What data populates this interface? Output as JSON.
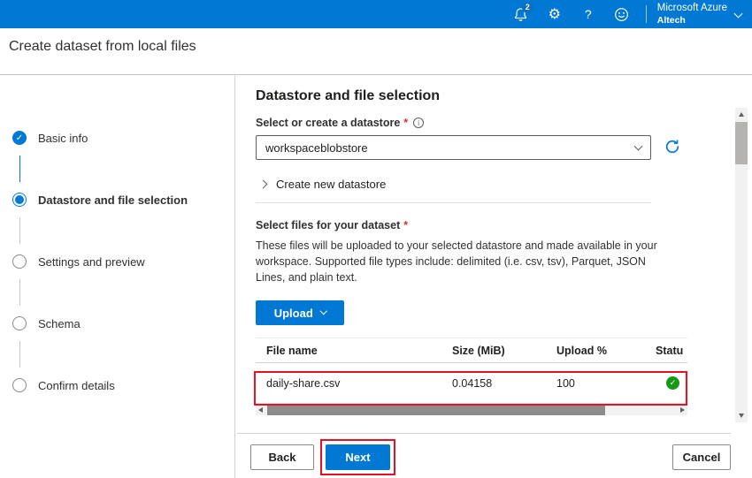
{
  "topbar": {
    "product": "Microsoft Azure",
    "directory": "Altech",
    "notification_count": "2",
    "help": "?"
  },
  "page": {
    "title": "Create dataset from local files"
  },
  "steps": [
    {
      "label": "Basic info",
      "state": "complete"
    },
    {
      "label": "Datastore and file selection",
      "state": "current"
    },
    {
      "label": "Settings and preview",
      "state": "upcoming"
    },
    {
      "label": "Schema",
      "state": "upcoming"
    },
    {
      "label": "Confirm details",
      "state": "upcoming"
    }
  ],
  "content": {
    "heading": "Datastore and file selection",
    "datastore": {
      "label": "Select or create a datastore",
      "required": "*",
      "selected": "workspaceblobstore",
      "create_new": "Create new datastore"
    },
    "files": {
      "label": "Select files for your dataset",
      "required": "*",
      "description": "These files will be uploaded to your selected datastore and made available in your workspace. Supported file types include: delimited (i.e. csv, tsv), Parquet, JSON Lines, and plain text.",
      "upload_button": "Upload"
    },
    "table": {
      "headers": [
        "File name",
        "Size (MiB)",
        "Upload %",
        "Statu"
      ],
      "rows": [
        {
          "file_name": "daily-share.csv",
          "size_mib": "0.04158",
          "upload_pct": "100",
          "status_icon": "success-check"
        }
      ]
    }
  },
  "footer": {
    "back_label": "Back",
    "next_label": "Next",
    "cancel_label": "Cancel"
  },
  "colors": {
    "accent": "#0078d4",
    "annotation_red": "#e81123",
    "success_green": "#189818"
  }
}
